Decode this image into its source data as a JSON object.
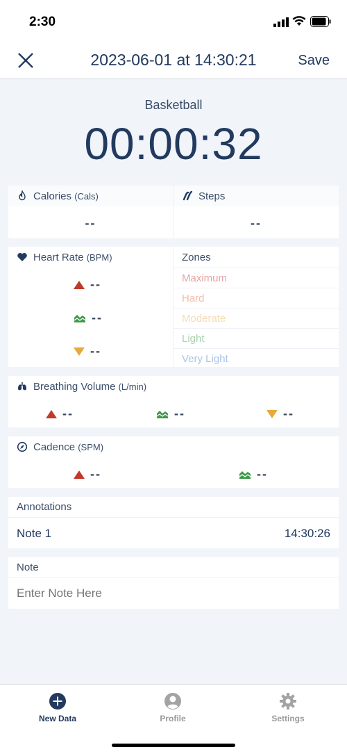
{
  "status_bar": {
    "time": "2:30"
  },
  "nav": {
    "title": "2023-06-01 at 14:30:21",
    "save_label": "Save"
  },
  "activity": {
    "name": "Basketball",
    "timer": "00:00:32"
  },
  "calories": {
    "label": "Calories",
    "unit": "(Cals)",
    "value": "--"
  },
  "steps": {
    "label": "Steps",
    "value": "--"
  },
  "heart_rate": {
    "label": "Heart Rate",
    "unit": "(BPM)",
    "max": "--",
    "avg": "--",
    "min": "--",
    "zones_label": "Zones",
    "zones": [
      "Maximum",
      "Hard",
      "Moderate",
      "Light",
      "Very Light"
    ]
  },
  "breathing": {
    "label": "Breathing Volume",
    "unit": "(L/min)",
    "max": "--",
    "avg": "--",
    "min": "--"
  },
  "cadence": {
    "label": "Cadence",
    "unit": "(SPM)",
    "max": "--",
    "avg": "--"
  },
  "annotations": {
    "label": "Annotations",
    "items": [
      {
        "name": "Note 1",
        "time": "14:30:26"
      }
    ]
  },
  "note": {
    "label": "Note",
    "placeholder": "Enter Note Here"
  },
  "tabs": [
    {
      "label": "New Data",
      "icon": "plus-circle-icon"
    },
    {
      "label": "Profile",
      "icon": "user-circle-icon"
    },
    {
      "label": "Settings",
      "icon": "gear-icon"
    }
  ],
  "colors": {
    "primary": "#223a5e",
    "up": "#c0392b",
    "avg": "#3d9a4a",
    "down": "#e8a93c",
    "zone_maximum": "#e3a4a4",
    "zone_hard": "#f0bfa6",
    "zone_moderate": "#f6dcb4",
    "zone_light": "#a9d3ae",
    "zone_very_light": "#a9c5ea"
  }
}
